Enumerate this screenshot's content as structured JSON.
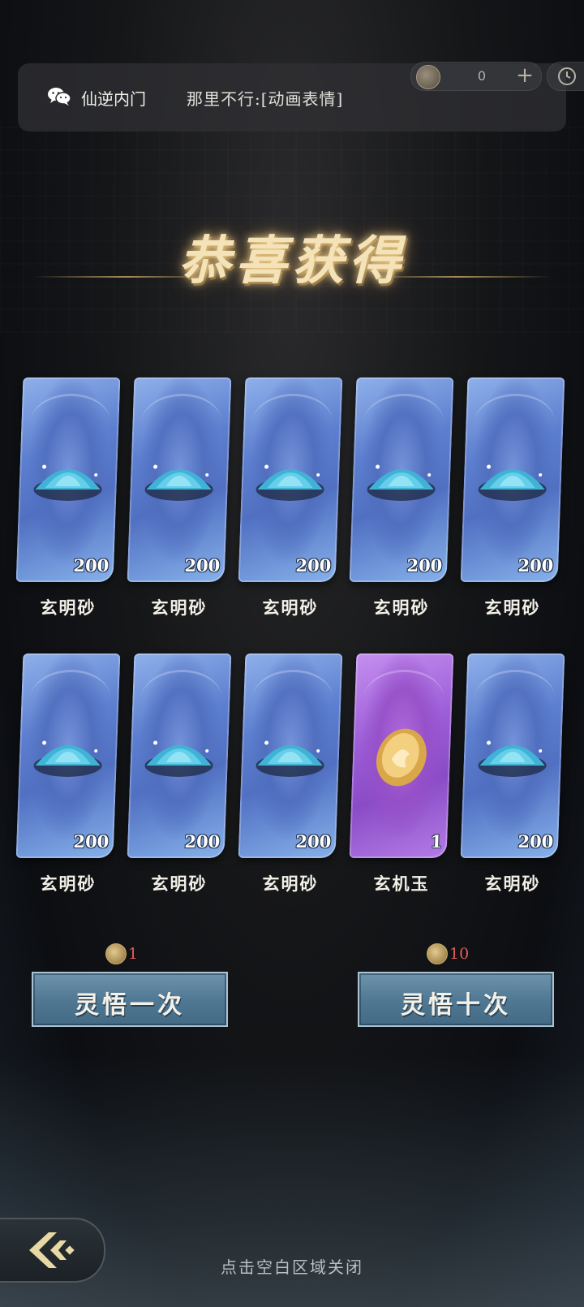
{
  "topbar": {
    "currency_count": "0",
    "plus": "+"
  },
  "notification": {
    "group": "仙逆内门",
    "message": "那里不行:[动画表情]"
  },
  "title": "恭喜获得",
  "rewards": [
    {
      "name": "玄明砂",
      "qty": "200",
      "rarity": "blue"
    },
    {
      "name": "玄明砂",
      "qty": "200",
      "rarity": "blue"
    },
    {
      "name": "玄明砂",
      "qty": "200",
      "rarity": "blue"
    },
    {
      "name": "玄明砂",
      "qty": "200",
      "rarity": "blue"
    },
    {
      "name": "玄明砂",
      "qty": "200",
      "rarity": "blue"
    },
    {
      "name": "玄明砂",
      "qty": "200",
      "rarity": "blue"
    },
    {
      "name": "玄明砂",
      "qty": "200",
      "rarity": "blue"
    },
    {
      "name": "玄明砂",
      "qty": "200",
      "rarity": "blue"
    },
    {
      "name": "玄机玉",
      "qty": "1",
      "rarity": "purple"
    },
    {
      "name": "玄明砂",
      "qty": "200",
      "rarity": "blue"
    }
  ],
  "actions": {
    "single": {
      "cost": "1",
      "label": "灵悟一次"
    },
    "ten": {
      "cost": "10",
      "label": "灵悟十次"
    }
  },
  "close_hint": "点击空白区域关闭",
  "colors": {
    "cost_red": "#e35c5c",
    "title_gold": "#f4e2b8",
    "button_blue": "#4f7792"
  }
}
